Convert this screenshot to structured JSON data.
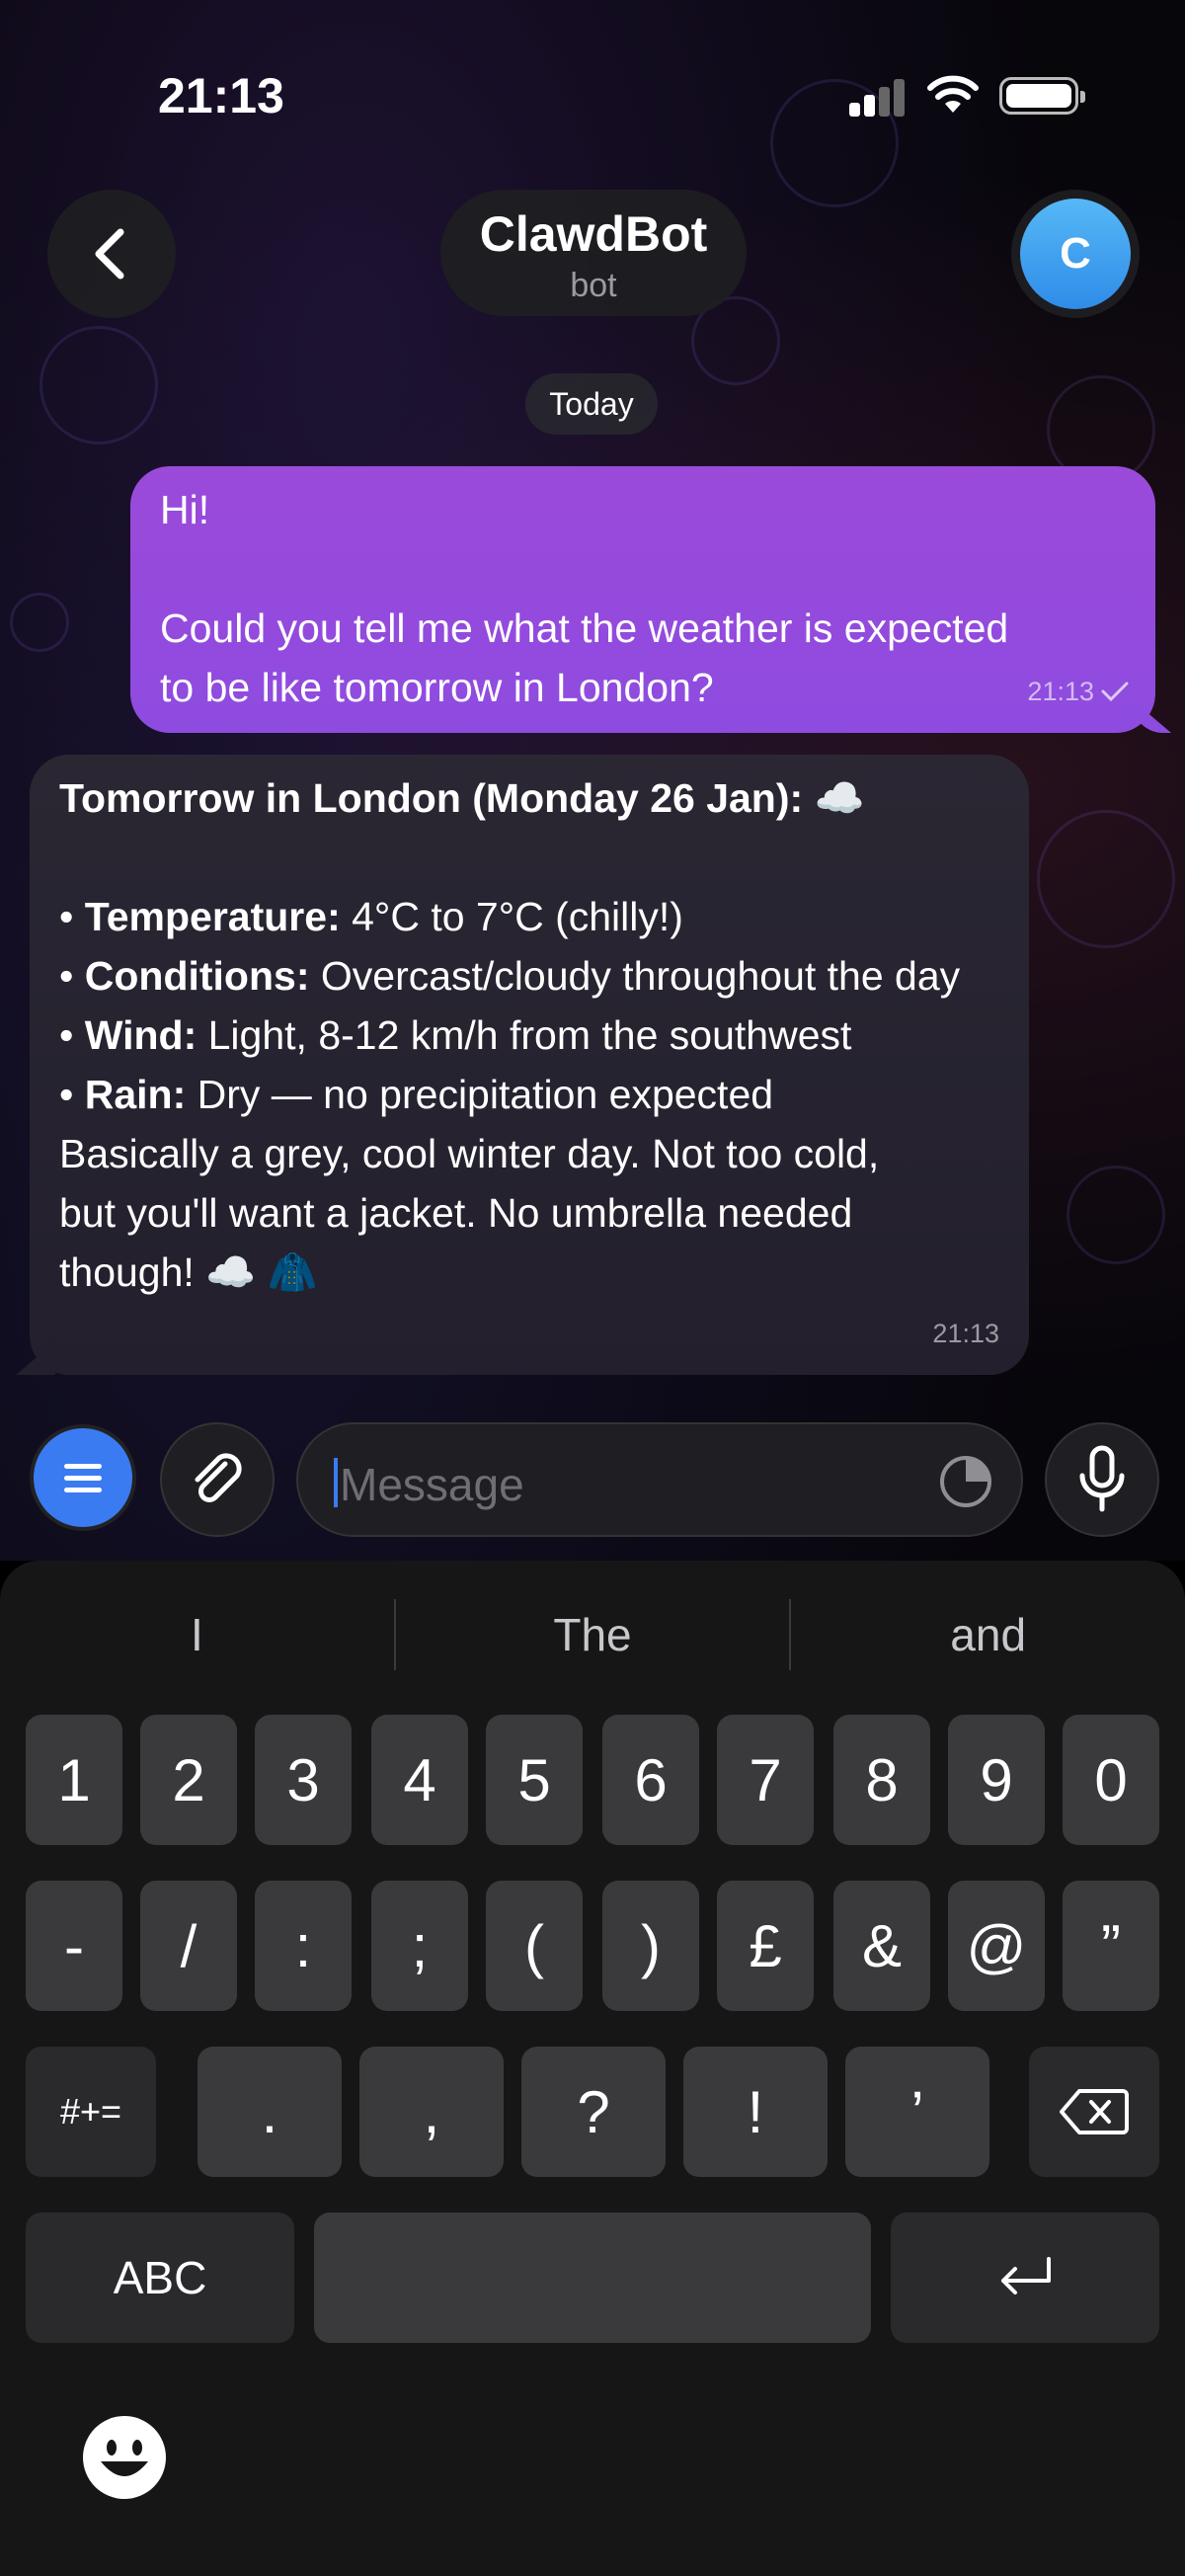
{
  "status_bar": {
    "time": "21:13"
  },
  "header": {
    "title": "ClawdBot",
    "subtitle": "bot",
    "avatar_letter": "C"
  },
  "date_separator": "Today",
  "messages": [
    {
      "direction": "outgoing",
      "lines": [
        "Hi!",
        "",
        "Could you tell me what the weather is expected",
        "to be like tomorrow in London?"
      ],
      "time": "21:13",
      "status": "sent"
    },
    {
      "direction": "incoming",
      "heading": "Tomorrow in London (Monday 26 Jan): ☁️",
      "items": [
        {
          "label": "Temperature:",
          "text": " 4°C to 7°C (chilly!)"
        },
        {
          "label": "Conditions:",
          "text": " Overcast/cloudy throughout the day"
        },
        {
          "label": "Wind:",
          "text": " Light, 8-12 km/h from the southwest"
        },
        {
          "label": "Rain:",
          "text": " Dry — no precipitation expected"
        }
      ],
      "summary": "Basically a grey, cool winter day. Not too cold, but you'll want a jacket. No umbrella needed though! ☁️ 🧥",
      "time": "21:13"
    }
  ],
  "composer": {
    "placeholder": "Message"
  },
  "keyboard": {
    "suggestions": [
      "I",
      "The",
      "and"
    ],
    "row1": [
      "1",
      "2",
      "3",
      "4",
      "5",
      "6",
      "7",
      "8",
      "9",
      "0"
    ],
    "row2": [
      "-",
      "/",
      ":",
      ";",
      "(",
      ")",
      "£",
      "&",
      "@",
      "”"
    ],
    "row3_left": "#+=",
    "row3": [
      ".",
      ",",
      "?",
      "!",
      "’"
    ],
    "abc_label": "ABC"
  }
}
